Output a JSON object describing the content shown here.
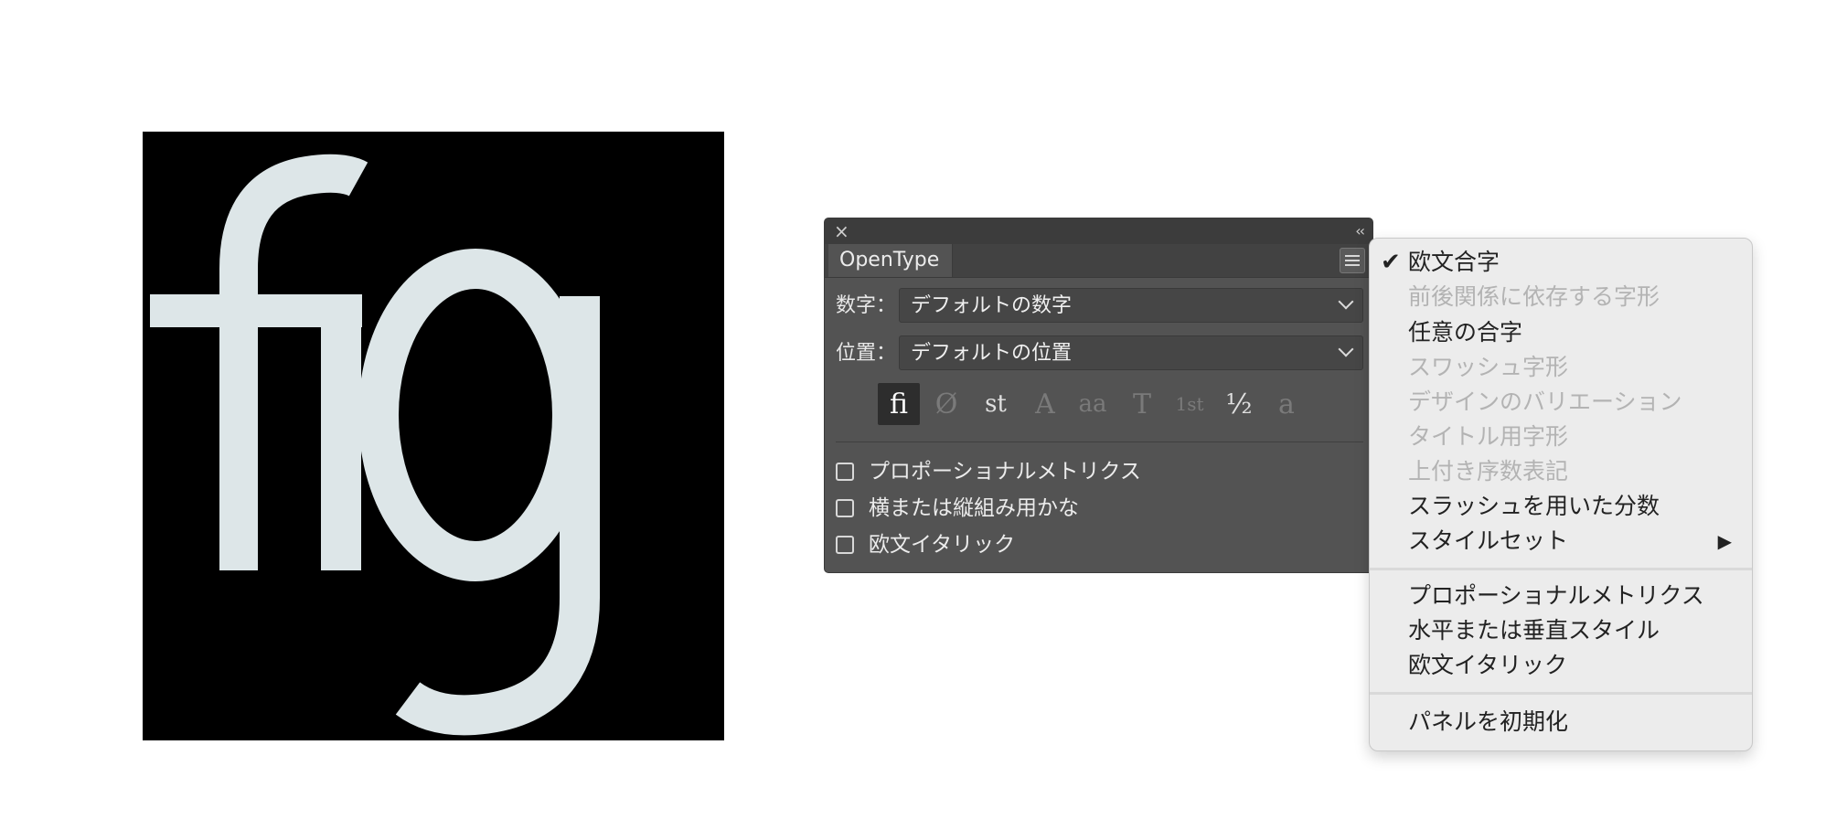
{
  "preview": {
    "sample_text": "fig",
    "background_color": "#000000",
    "glyph_color": "#dde6e8"
  },
  "panel": {
    "title": "OpenType",
    "close_symbol": "×",
    "collapse_symbol": "‹‹",
    "numerals_label": "数字：",
    "numerals_value": "デフォルトの数字",
    "position_label": "位置：",
    "position_value": "デフォルトの位置",
    "glyph_buttons": [
      {
        "icon": "standard-ligatures-icon",
        "glyph": "ﬁ",
        "state": "active"
      },
      {
        "icon": "contextual-alternates-icon",
        "glyph": "Ø",
        "state": "disabled"
      },
      {
        "icon": "discretionary-ligatures-icon",
        "glyph": "st",
        "state": "on"
      },
      {
        "icon": "swash-icon",
        "glyph": "A",
        "state": "disabled"
      },
      {
        "icon": "stylistic-alternates-icon",
        "glyph": "aa",
        "state": "disabled"
      },
      {
        "icon": "titling-alternates-icon",
        "glyph": "T",
        "state": "disabled"
      },
      {
        "icon": "ordinals-icon",
        "glyph": "1st",
        "state": "disabled"
      },
      {
        "icon": "fractions-icon",
        "glyph": "½",
        "state": "on"
      },
      {
        "icon": "stylistic-sets-icon",
        "glyph": "a",
        "state": "disabled"
      }
    ],
    "checkboxes": [
      {
        "label": "プロポーショナルメトリクス",
        "checked": false
      },
      {
        "label": "横または縦組み用かな",
        "checked": false
      },
      {
        "label": "欧文イタリック",
        "checked": false
      }
    ]
  },
  "menu": {
    "check_symbol": "✔",
    "submenu_arrow": "▶",
    "groups": [
      [
        {
          "label": "欧文合字",
          "checked": true,
          "enabled": true
        },
        {
          "label": "前後関係に依存する字形",
          "checked": false,
          "enabled": false
        },
        {
          "label": "任意の合字",
          "checked": false,
          "enabled": true
        },
        {
          "label": "スワッシュ字形",
          "checked": false,
          "enabled": false
        },
        {
          "label": "デザインのバリエーション",
          "checked": false,
          "enabled": false
        },
        {
          "label": "タイトル用字形",
          "checked": false,
          "enabled": false
        },
        {
          "label": "上付き序数表記",
          "checked": false,
          "enabled": false
        },
        {
          "label": "スラッシュを用いた分数",
          "checked": false,
          "enabled": true
        },
        {
          "label": "スタイルセット",
          "checked": false,
          "enabled": true,
          "submenu": true
        }
      ],
      [
        {
          "label": "プロポーショナルメトリクス",
          "enabled": true
        },
        {
          "label": "水平または垂直スタイル",
          "enabled": true
        },
        {
          "label": "欧文イタリック",
          "enabled": true
        }
      ],
      [
        {
          "label": "パネルを初期化",
          "enabled": true
        }
      ]
    ]
  }
}
